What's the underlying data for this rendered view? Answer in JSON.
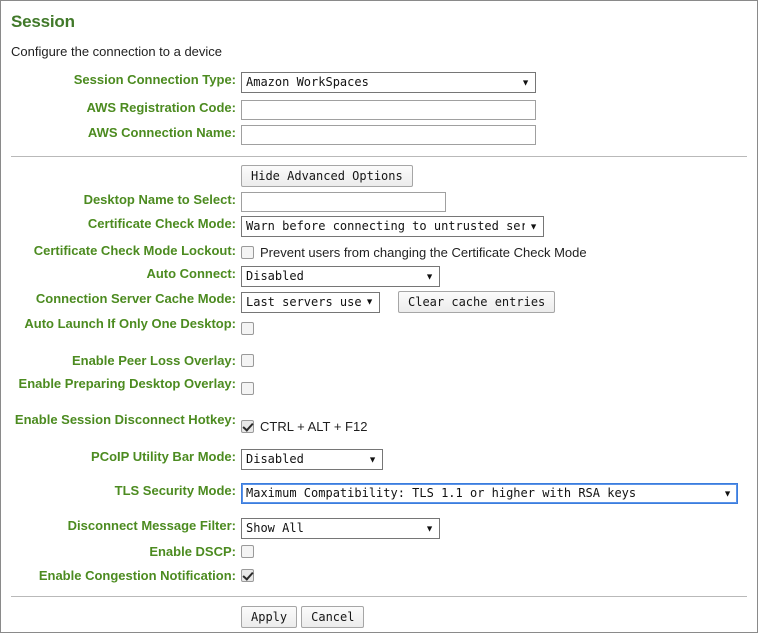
{
  "page": {
    "title": "Session",
    "subtitle": "Configure the connection to a device"
  },
  "colors": {
    "label_green": "#4c8b20",
    "title_green": "#41792a",
    "focus_blue": "#3b7ddd"
  },
  "basic": {
    "connection_type": {
      "label": "Session Connection Type:",
      "value": "Amazon WorkSpaces"
    },
    "registration_code": {
      "label": "AWS Registration Code:",
      "value": "",
      "placeholder": ""
    },
    "connection_name": {
      "label": "AWS Connection Name:",
      "value": "",
      "placeholder": ""
    }
  },
  "advanced": {
    "toggle_button": "Hide Advanced Options",
    "desktop_name": {
      "label": "Desktop Name to Select:",
      "value": "",
      "placeholder": ""
    },
    "cert_check_mode": {
      "label": "Certificate Check Mode:",
      "value": "Warn before connecting to untrusted servers"
    },
    "cert_check_lockout": {
      "label": "Certificate Check Mode Lockout:",
      "checkbox_text": "Prevent users from changing the Certificate Check Mode",
      "checked": false
    },
    "auto_connect": {
      "label": "Auto Connect:",
      "value": "Disabled"
    },
    "cache_mode": {
      "label": "Connection Server Cache Mode:",
      "value": "Last servers used",
      "clear_button": "Clear cache entries"
    },
    "auto_launch": {
      "label": "Auto Launch If Only One Desktop:",
      "checked": false
    },
    "peer_loss_overlay": {
      "label": "Enable Peer Loss Overlay:",
      "checked": false
    },
    "preparing_desktop_overlay": {
      "label": "Enable Preparing Desktop Overlay:",
      "checked": false
    },
    "disconnect_hotkey": {
      "label": "Enable Session Disconnect Hotkey:",
      "checkbox_text": "CTRL + ALT + F12",
      "checked": true
    },
    "pcoip_utility_bar": {
      "label": "PCoIP Utility Bar Mode:",
      "value": "Disabled"
    },
    "tls_security_mode": {
      "label": "TLS Security Mode:",
      "value": "Maximum Compatibility: TLS 1.1 or higher with RSA keys"
    },
    "disconnect_message_filter": {
      "label": "Disconnect Message Filter:",
      "value": "Show All"
    },
    "enable_dscp": {
      "label": "Enable DSCP:",
      "checked": false
    },
    "enable_congestion_notification": {
      "label": "Enable Congestion Notification:",
      "checked": true
    }
  },
  "footer": {
    "apply": "Apply",
    "cancel": "Cancel"
  },
  "icons": {
    "dropdown_arrow": "▼"
  }
}
